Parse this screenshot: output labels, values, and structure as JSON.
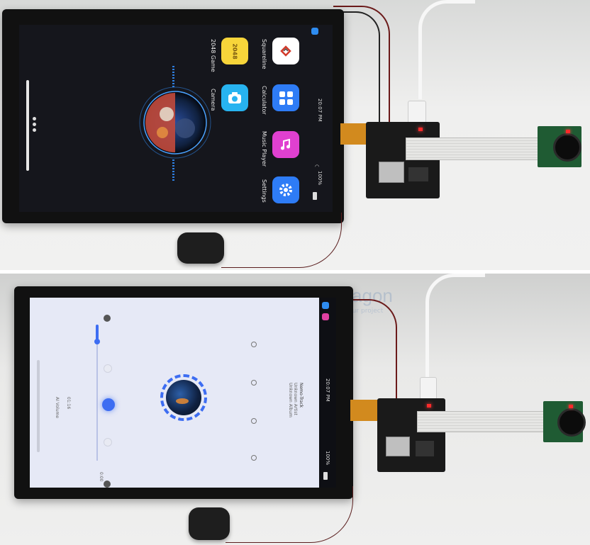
{
  "top": {
    "status_bar": {
      "time": "20:07 PM",
      "battery": "100%"
    },
    "apps": [
      {
        "label": "Squareline"
      },
      {
        "label": "2048 Game",
        "glyph": "2048"
      },
      {
        "label": "Calculator"
      },
      {
        "label": "Camera"
      },
      {
        "label": "Music Player"
      },
      {
        "label": "Settings"
      }
    ]
  },
  "bottom": {
    "status_bar": {
      "time": "20:07 PM",
      "battery": "100%"
    },
    "player": {
      "track_title": "Nemo-Track",
      "artist": "Unknown Artist",
      "album": "Unknown Album",
      "time_elapsed": "0:00",
      "duration": "01:16",
      "volume_label": "AI Volume"
    },
    "watermark": {
      "brand": "Electrodragon",
      "tagline": "Microcontrollers for your project"
    }
  },
  "colors": {
    "accent": "#3d6df2",
    "dark_screen": "#15161c",
    "light_screen": "#e6e9f6",
    "pcb": "#1f5b33",
    "fpc": "#d28a1e"
  },
  "icons": [
    "wifi-icon",
    "battery-icon",
    "play-pause-icon",
    "prev-icon",
    "next-icon",
    "shuffle-icon",
    "repeat-icon",
    "list-icon",
    "lock-icon",
    "info-icon"
  ]
}
